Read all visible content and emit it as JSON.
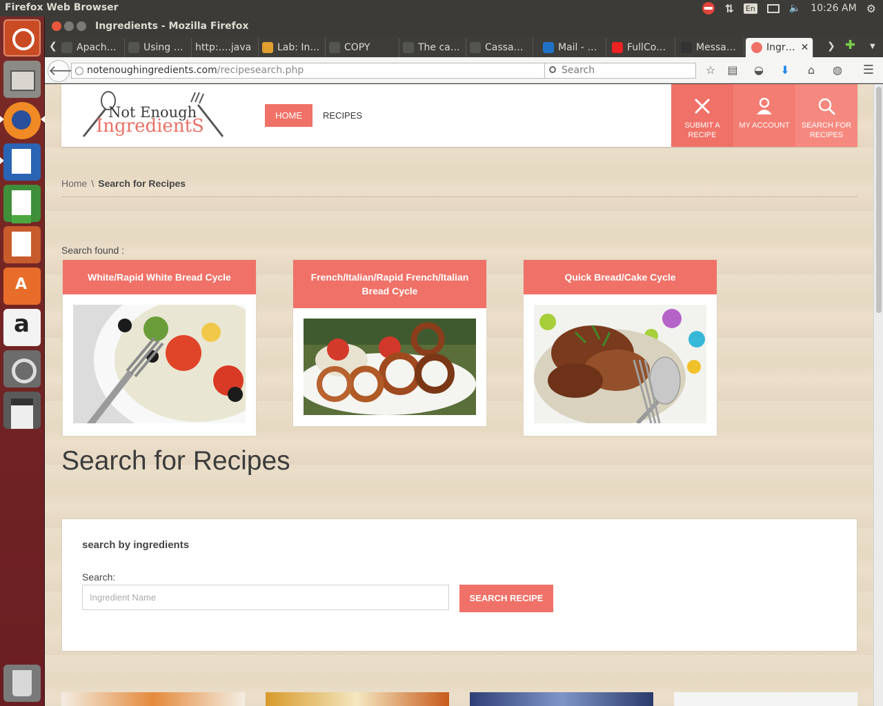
{
  "os": {
    "app_title": "Firefox Web Browser",
    "keyboard_layout": "En",
    "clock": "10:26 AM"
  },
  "window": {
    "title": "Ingredients - Mozilla Firefox"
  },
  "tabs": [
    {
      "label": "Apach…",
      "icon": "loading-icon"
    },
    {
      "label": "Using …",
      "icon": "loading-icon"
    },
    {
      "label": "http:….java",
      "icon": "none"
    },
    {
      "label": "Lab: In…",
      "icon": "lab-icon"
    },
    {
      "label": "COPY",
      "icon": "loading-icon"
    },
    {
      "label": "The ca…",
      "icon": "loading-icon"
    },
    {
      "label": "Cassa…",
      "icon": "loading-icon"
    },
    {
      "label": "Mail - …",
      "icon": "outlook-icon"
    },
    {
      "label": "FullCo…",
      "icon": "youtube-icon"
    },
    {
      "label": "Messa…",
      "icon": "messenger-icon"
    },
    {
      "label": "Ingr…",
      "icon": "site-icon",
      "active": true
    }
  ],
  "navbar": {
    "url_host": "notenoughingredients.com",
    "url_path": "/recipesearch.php",
    "search_placeholder": "Search"
  },
  "site": {
    "logo_line1": "Not Enough",
    "logo_line2": "IngredientS",
    "nav": {
      "home": "HOME",
      "recipes": "RECIPES"
    },
    "actions": [
      {
        "label": "SUBMIT A RECIPE",
        "icon": "utensils-icon"
      },
      {
        "label": "MY ACCOUNT",
        "icon": "user-icon"
      },
      {
        "label": "SEARCH FOR RECIPES",
        "icon": "search-icon"
      }
    ]
  },
  "breadcrumb": {
    "home": "Home",
    "separator": "\\",
    "current": "Search for Recipes"
  },
  "results": {
    "label": "Search found :",
    "cards": [
      {
        "title": "White/Rapid White Bread Cycle",
        "image": "salad-photo"
      },
      {
        "title": "French/Italian/Rapid French/Italian Bread Cycle",
        "image": "onion-rings-photo"
      },
      {
        "title": "Quick Bread/Cake Cycle",
        "image": "rice-dish-photo"
      }
    ]
  },
  "heading": "Search for Recipes",
  "search_panel": {
    "title": "search by ingredients",
    "label": "Search:",
    "input_placeholder": "Ingredient Name",
    "input_value": "",
    "button": "SEARCH RECIPE"
  },
  "colors": {
    "accent": "#f07167",
    "page_bg": "#e9dcc7"
  }
}
